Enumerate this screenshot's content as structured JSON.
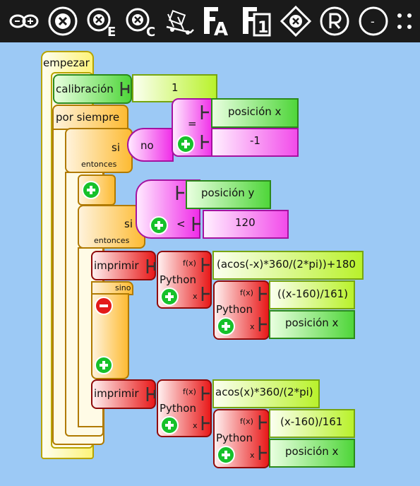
{
  "toolbar": {
    "icons": [
      "arduino-icon",
      "close-circle-icon",
      "close-e-icon",
      "close-c-icon",
      "sled-icon",
      "font-a-icon",
      "font-1-icon",
      "diamond-close-icon",
      "registered-icon",
      "minus-circle-icon",
      "more-icon"
    ],
    "e_letter": "E",
    "c_letter": "C",
    "a_letter": "A",
    "one_letter": "1",
    "minus_label": "-"
  },
  "blocks": {
    "start_label": "empezar",
    "calibration_label": "calibración",
    "calibration_value": "1",
    "forever_label": "por siempre",
    "if1_label": "si",
    "then1_label": "entonces",
    "not_label": "no",
    "equals_label": "=",
    "pos_x_1": "posición x",
    "neg_one": "-1",
    "if2_label": "si",
    "then2_label": "entonces",
    "pos_y": "posición y",
    "less_label": "<",
    "value_120": "120",
    "print1_label": "imprimir",
    "else_label": "sino",
    "fx1_label": "f(x)",
    "python1_label": "Python",
    "x1_label": "x",
    "expr1": "(acos(-x)*360/(2*pi))+180",
    "fx2_label": "f(x)",
    "python2_label": "Python",
    "x2_label": "x",
    "expr2": "((x-160)/161)",
    "pos_x_2": "posición x",
    "print2_label": "imprimir",
    "fx3_label": "f(x)",
    "python3_label": "Python",
    "x3_label": "x",
    "expr3": "acos(x)*360/(2*pi)",
    "fx4_label": "f(x)",
    "python4_label": "Python",
    "x4_label": "x",
    "expr4": "(x-160)/161",
    "pos_x_3": "posición x"
  }
}
